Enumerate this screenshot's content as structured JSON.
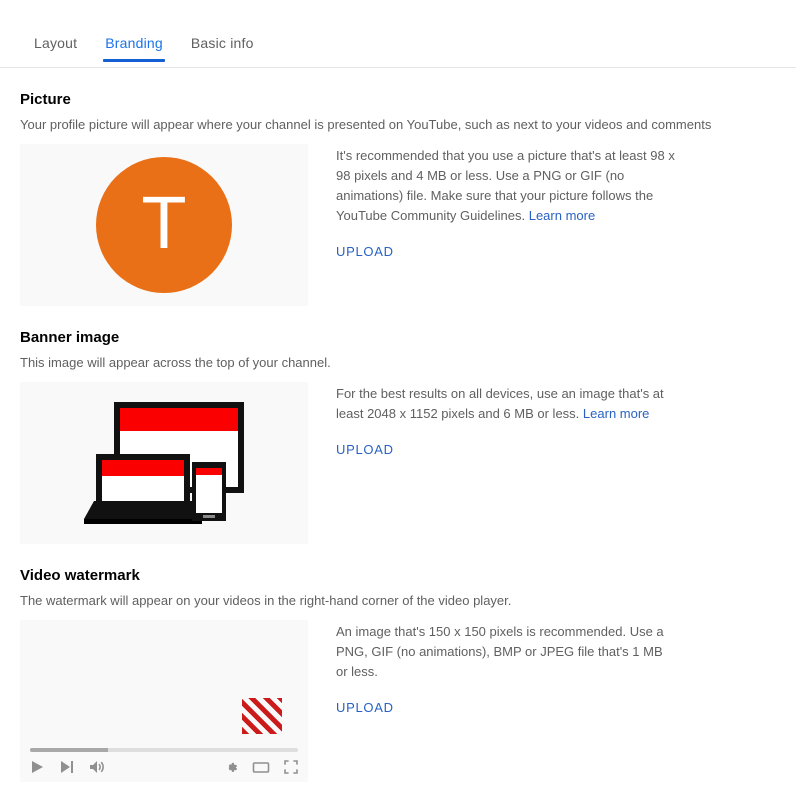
{
  "tabs": [
    {
      "label": "Layout",
      "active": false
    },
    {
      "label": "Branding",
      "active": true
    },
    {
      "label": "Basic info",
      "active": false
    }
  ],
  "colors": {
    "active_tab": "#1a73e8",
    "tab_underline": "#155fd4",
    "link": "#2962c4",
    "avatar_background": "#ea7017",
    "banner_accent": "#fb0000",
    "watermark_stripe": "#cc1b1b",
    "preview_background": "#f9f9f9"
  },
  "sections": {
    "picture": {
      "title": "Picture",
      "subtitle": "Your profile picture will appear where your channel is presented on YouTube, such as next to your videos and comments",
      "avatar_letter": "T",
      "description": "It's recommended that you use a picture that's at least 98 x 98 pixels and 4 MB or less. Use a PNG or GIF (no animations) file. Make sure that your picture follows the YouTube Community Guidelines.",
      "learn_more": "Learn more",
      "upload_label": "UPLOAD"
    },
    "banner": {
      "title": "Banner image",
      "subtitle": "This image will appear across the top of your channel.",
      "description": "For the best results on all devices, use an image that's at least 2048 x 1152 pixels and 6 MB or less.",
      "learn_more": "Learn more",
      "upload_label": "UPLOAD"
    },
    "watermark": {
      "title": "Video watermark",
      "subtitle": "The watermark will appear on your videos in the right-hand corner of the video player.",
      "description": "An image that's 150 x 150 pixels is recommended. Use a PNG, GIF (no animations), BMP or JPEG file that's 1 MB or less.",
      "upload_label": "UPLOAD"
    }
  },
  "player_controls": {
    "progress_percent": 29,
    "left": [
      "play-icon",
      "next-icon",
      "volume-icon"
    ],
    "right": [
      "settings-gear-icon",
      "miniplayer-icon",
      "fullscreen-icon"
    ]
  }
}
